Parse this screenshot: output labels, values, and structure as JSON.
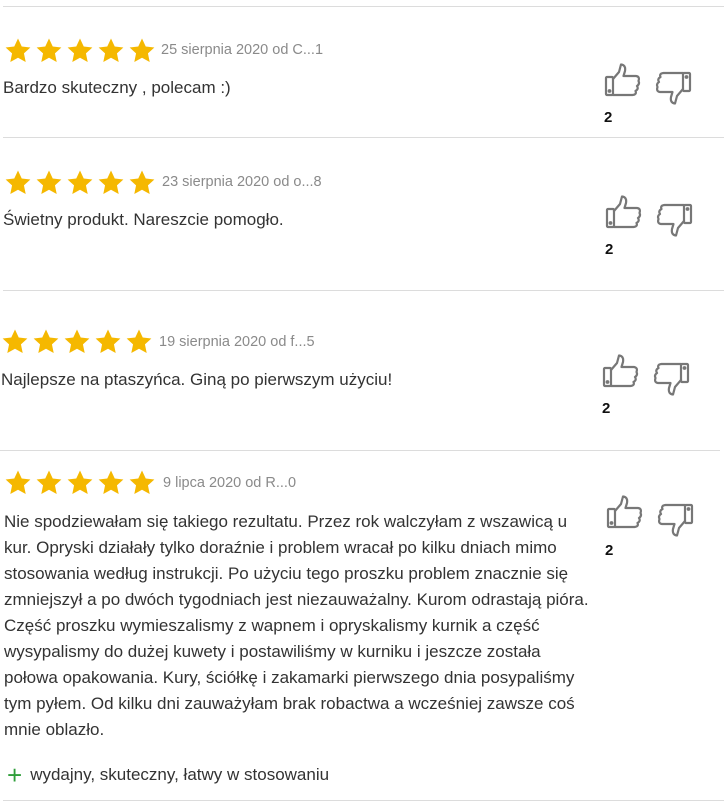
{
  "colors": {
    "star": "#f5b800",
    "divider": "#dcdcdc",
    "text": "#333333",
    "meta": "#8a8a8a",
    "icon": "#777777",
    "plus": "#2f9e3a"
  },
  "reviews": [
    {
      "rating": 5,
      "meta": "25 sierpnia 2020 od C...1",
      "text": "Bardzo skuteczny , polecam :)",
      "likes": "2"
    },
    {
      "rating": 5,
      "meta": "23 sierpnia 2020 od o...8",
      "text": "Świetny produkt. Nareszcie pomogło.",
      "likes": "2"
    },
    {
      "rating": 5,
      "meta": "19 sierpnia 2020 od f...5",
      "text": "Najlepsze na ptaszyńca. Giną po pierwszym użyciu!",
      "likes": "2"
    },
    {
      "rating": 5,
      "meta": "9 lipca 2020 od R...0",
      "text": "Nie spodziewałam się takiego rezultatu. Przez rok walczyłam z wszawicą u kur. Opryski działały tylko doraźnie i problem wracał po kilku dniach mimo stosowania według instrukcji. Po użyciu tego proszku problem znacznie się zmniejszył a po dwóch tygodniach jest niezauważalny. Kurom odrastają pióra. Część proszku wymieszalismy z wapnem i opryskalismy kurnik a część wysypalismy do dużej kuwety i postawiliśmy w kurniku i jeszcze została połowa opakowania. Kury, ściółkę i zakamarki pierwszego dnia posypaliśmy tym pyłem. Od kilku dni zauważyłam brak robactwa a wcześniej zawsze coś mnie oblazło.",
      "likes": "2",
      "pros_symbol": "+",
      "pros": "wydajny, skuteczny, łatwy w stosowaniu"
    }
  ],
  "icons": {
    "like": "thumbs-up-icon",
    "dislike": "thumbs-down-icon",
    "star": "star-icon"
  }
}
